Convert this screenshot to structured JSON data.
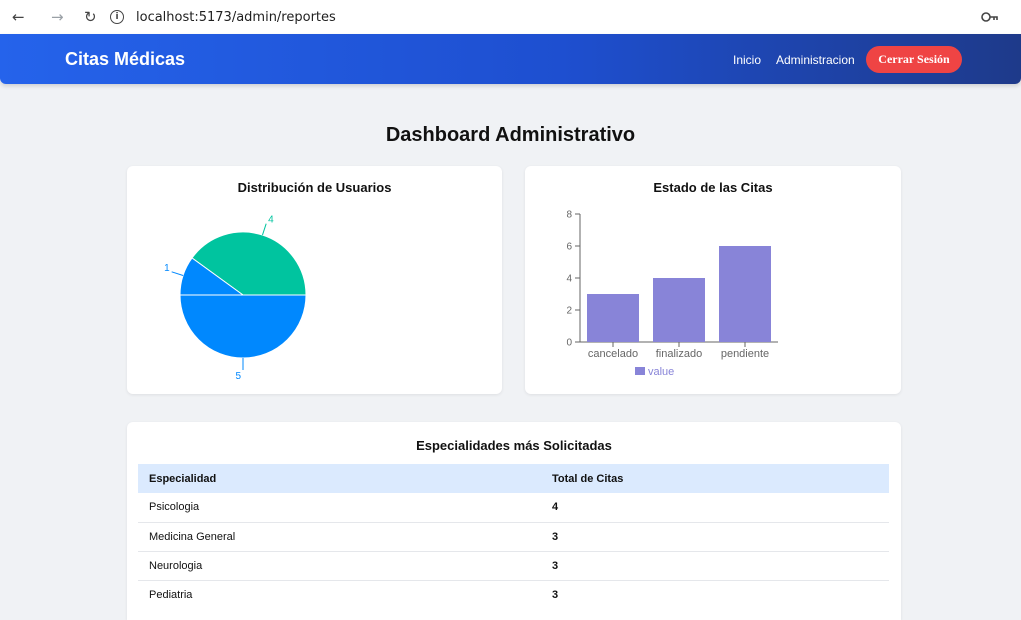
{
  "browser": {
    "url": "localhost:5173/admin/reportes"
  },
  "navbar": {
    "brand": "Citas Médicas",
    "links": [
      "Inicio",
      "Administracion"
    ],
    "logout_label": "Cerrar Sesión"
  },
  "page": {
    "title": "Dashboard Administrativo"
  },
  "users_card": {
    "title": "Distribución de Usuarios"
  },
  "citas_card": {
    "title": "Estado de las Citas"
  },
  "specialties": {
    "title": "Especialidades más Solicitadas",
    "headers": [
      "Especialidad",
      "Total de Citas"
    ],
    "rows": [
      {
        "name": "Psicologia",
        "total": "4"
      },
      {
        "name": "Medicina General",
        "total": "3"
      },
      {
        "name": "Neurologia",
        "total": "3"
      },
      {
        "name": "Pediatria",
        "total": "3"
      }
    ]
  },
  "chart_data": [
    {
      "type": "pie",
      "values": [
        4,
        1,
        5
      ],
      "labels": [
        "4",
        "1",
        "5"
      ],
      "colors": [
        "#00c49f",
        "#0088fe",
        "#0088fe"
      ]
    },
    {
      "type": "bar",
      "categories": [
        "cancelado",
        "finalizado",
        "pendiente"
      ],
      "series": [
        {
          "name": "value",
          "values": [
            3,
            4,
            6
          ]
        }
      ],
      "ylim": [
        0,
        8
      ],
      "yticks": [
        0,
        2,
        4,
        6,
        8
      ],
      "color": "#8884d8",
      "legend": "bottom"
    }
  ]
}
